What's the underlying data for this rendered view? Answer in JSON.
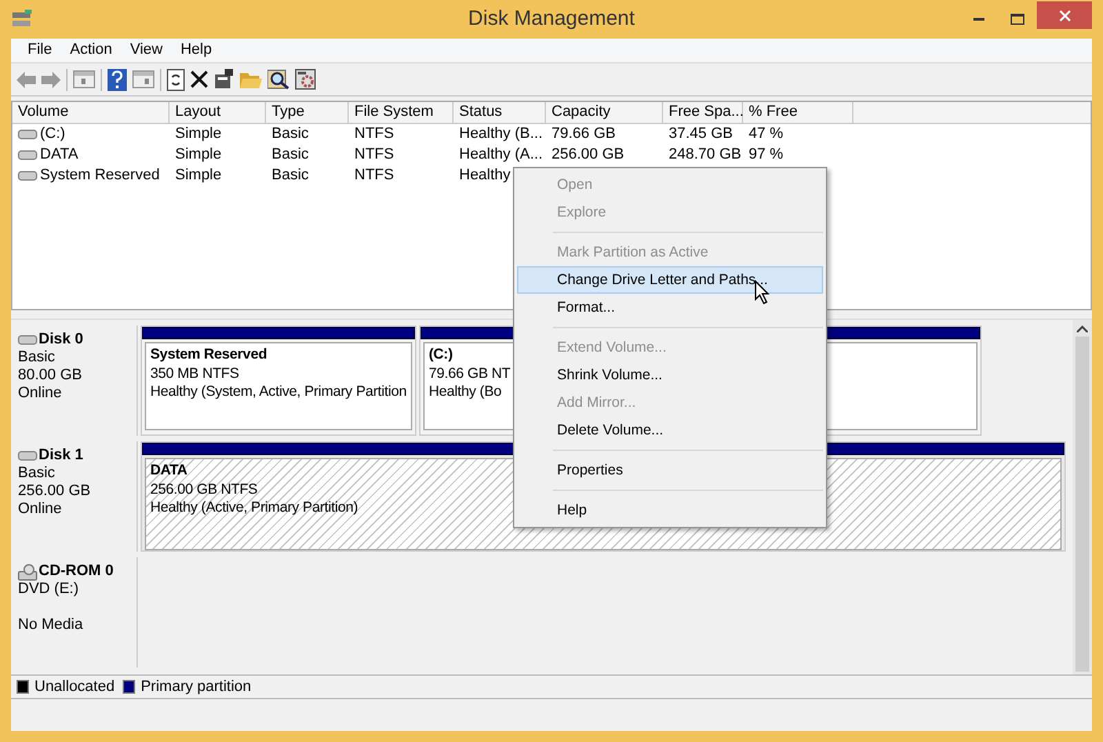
{
  "window": {
    "title": "Disk Management"
  },
  "menu_bar": [
    "File",
    "Action",
    "View",
    "Help"
  ],
  "volume_list": {
    "columns": [
      "Volume",
      "Layout",
      "Type",
      "File System",
      "Status",
      "Capacity",
      "Free Spa...",
      "% Free"
    ],
    "rows": [
      {
        "cells": [
          "(C:)",
          "Simple",
          "Basic",
          "NTFS",
          "Healthy (B...",
          "79.66 GB",
          "37.45 GB",
          "47 %"
        ]
      },
      {
        "cells": [
          "DATA",
          "Simple",
          "Basic",
          "NTFS",
          "Healthy (A...",
          "256.00 GB",
          "248.70 GB",
          "97 %"
        ]
      },
      {
        "cells": [
          "System Reserved",
          "Simple",
          "Basic",
          "NTFS",
          "Healthy"
        ]
      }
    ]
  },
  "disks": [
    {
      "kind": "disk",
      "name": "Disk 0",
      "type": "Basic",
      "size": "80.00 GB",
      "status": "Online",
      "partitions": [
        {
          "name": "System Reserved",
          "size": "350 MB NTFS",
          "status": "Healthy (System, Active, Primary Partition",
          "selected": false
        },
        {
          "name": "(C:)",
          "size": "79.66 GB NT",
          "status": "Healthy (Bo",
          "selected": false
        }
      ]
    },
    {
      "kind": "disk",
      "name": "Disk 1",
      "type": "Basic",
      "size": "256.00 GB",
      "status": "Online",
      "partitions": [
        {
          "name": "DATA",
          "size": "256.00 GB NTFS",
          "status": "Healthy (Active, Primary Partition)",
          "selected": true
        }
      ]
    },
    {
      "kind": "cdrom",
      "name": "CD-ROM 0",
      "type": "DVD (E:)",
      "status": "No Media"
    }
  ],
  "legend": [
    {
      "label": "Unallocated",
      "color": "#000000"
    },
    {
      "label": "Primary partition",
      "color": "#000080"
    }
  ],
  "context_menu": [
    {
      "kind": "item",
      "label": "Open",
      "disabled": true,
      "selected": false
    },
    {
      "kind": "item",
      "label": "Explore",
      "disabled": true,
      "selected": false
    },
    {
      "kind": "separator"
    },
    {
      "kind": "item",
      "label": "Mark Partition as Active",
      "disabled": true,
      "selected": false
    },
    {
      "kind": "item",
      "label": "Change Drive Letter and Paths...",
      "disabled": false,
      "selected": true
    },
    {
      "kind": "item",
      "label": "Format...",
      "disabled": false,
      "selected": false
    },
    {
      "kind": "separator"
    },
    {
      "kind": "item",
      "label": "Extend Volume...",
      "disabled": true,
      "selected": false
    },
    {
      "kind": "item",
      "label": "Shrink Volume...",
      "disabled": false,
      "selected": false
    },
    {
      "kind": "item",
      "label": "Add Mirror...",
      "disabled": true,
      "selected": false
    },
    {
      "kind": "item",
      "label": "Delete Volume...",
      "disabled": false,
      "selected": false
    },
    {
      "kind": "separator"
    },
    {
      "kind": "item",
      "label": "Properties",
      "disabled": false,
      "selected": false
    },
    {
      "kind": "separator"
    },
    {
      "kind": "item",
      "label": "Help",
      "disabled": false,
      "selected": false
    }
  ]
}
